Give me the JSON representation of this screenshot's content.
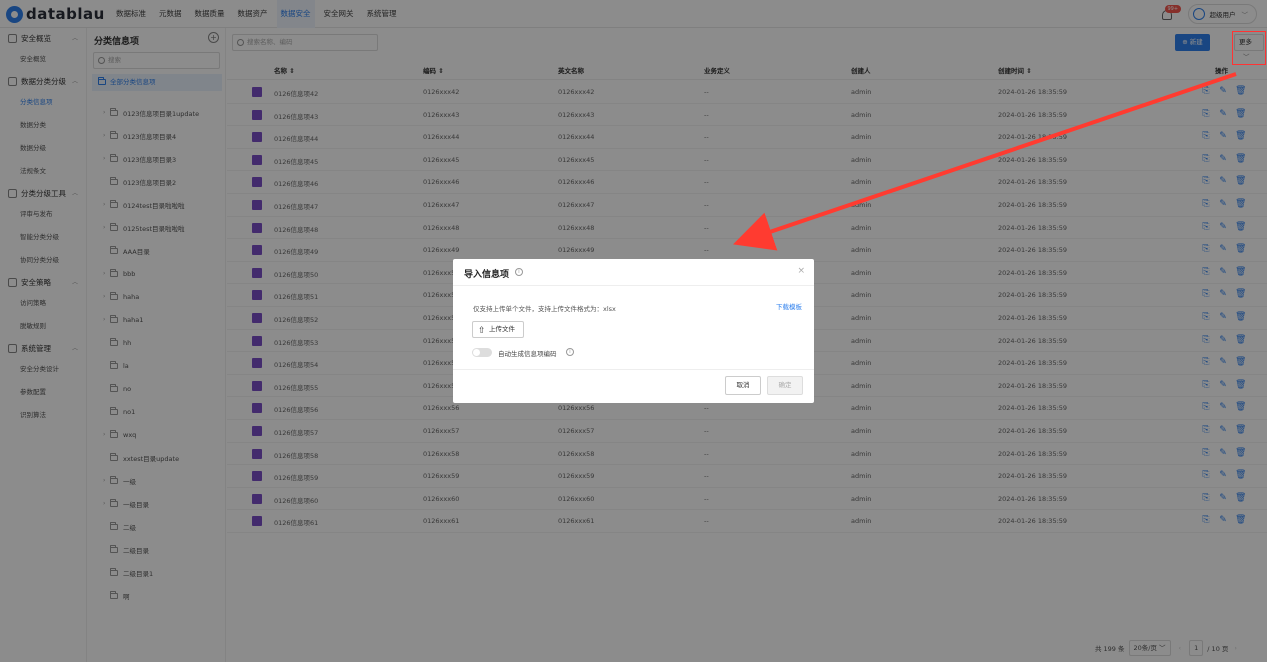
{
  "app": {
    "logo_text": "datablau"
  },
  "topnav": [
    {
      "label": "数据标准",
      "active": false
    },
    {
      "label": "元数据",
      "active": false
    },
    {
      "label": "数据质量",
      "active": false
    },
    {
      "label": "数据资产",
      "active": false
    },
    {
      "label": "数据安全",
      "active": true
    },
    {
      "label": "安全网关",
      "active": false
    },
    {
      "label": "系统管理",
      "active": false
    }
  ],
  "header": {
    "badge": "99+",
    "user": "超级用户"
  },
  "sidebar": {
    "groups": [
      {
        "label": "安全概览",
        "icon": "overview-icon",
        "items": [
          {
            "label": "安全概览"
          }
        ]
      },
      {
        "label": "数据分类分级",
        "icon": "grid-icon",
        "items": [
          {
            "label": "分类信息项",
            "active": true
          },
          {
            "label": "数据分类"
          },
          {
            "label": "数据分级"
          },
          {
            "label": "法规条文"
          }
        ]
      },
      {
        "label": "分类分级工具",
        "icon": "tool-icon",
        "items": [
          {
            "label": "评审与发布"
          },
          {
            "label": "智能分类分级"
          },
          {
            "label": "协同分类分级"
          }
        ]
      },
      {
        "label": "安全策略",
        "icon": "policy-icon",
        "items": [
          {
            "label": "访问策略"
          },
          {
            "label": "脱敏规则"
          }
        ]
      },
      {
        "label": "系统管理",
        "icon": "system-icon",
        "items": [
          {
            "label": "安全分类设计"
          },
          {
            "label": "参数配置"
          },
          {
            "label": "识别算法"
          }
        ]
      }
    ]
  },
  "tree_panel": {
    "title": "分类信息项",
    "search_placeholder": "搜索",
    "all_label": "全部分类信息项",
    "nodes": [
      {
        "label": "0123信息项目录1update",
        "expandable": true
      },
      {
        "label": "0123信息项目录4",
        "expandable": true
      },
      {
        "label": "0123信息项目录3",
        "expandable": true
      },
      {
        "label": "0123信息项目录2",
        "expandable": false
      },
      {
        "label": "0124test目录啦啦啦",
        "expandable": true
      },
      {
        "label": "0125test目录啦啦啦",
        "expandable": true
      },
      {
        "label": "AAA目录",
        "expandable": false
      },
      {
        "label": "bbb",
        "expandable": true
      },
      {
        "label": "haha",
        "expandable": true
      },
      {
        "label": "haha1",
        "expandable": true
      },
      {
        "label": "hh",
        "expandable": false
      },
      {
        "label": "la",
        "expandable": false
      },
      {
        "label": "no",
        "expandable": false
      },
      {
        "label": "no1",
        "expandable": false
      },
      {
        "label": "wxq",
        "expandable": true
      },
      {
        "label": "xxtest目录update",
        "expandable": false
      },
      {
        "label": "一级",
        "expandable": true
      },
      {
        "label": "一级目录",
        "expandable": true
      },
      {
        "label": "二级",
        "expandable": false
      },
      {
        "label": "二级目录",
        "expandable": false
      },
      {
        "label": "二级目录1",
        "expandable": false
      },
      {
        "label": "啊",
        "expandable": false
      }
    ]
  },
  "toolbar": {
    "search_placeholder": "搜索名称、编码",
    "new_label": "新建",
    "more_label": "更多"
  },
  "table": {
    "headers": {
      "name": "名称 ⇕",
      "code": "编码 ⇕",
      "en": "英文名称",
      "biz": "业务定义",
      "creator": "创建人",
      "created": "创建时间 ⇕",
      "ops": "操作"
    },
    "rows": [
      {
        "name": "0126信息项42",
        "code": "0126xxx42",
        "en": "0126xxx42",
        "biz": "--",
        "creator": "admin",
        "created": "2024-01-26 18:35:59"
      },
      {
        "name": "0126信息项43",
        "code": "0126xxx43",
        "en": "0126xxx43",
        "biz": "--",
        "creator": "admin",
        "created": "2024-01-26 18:35:59"
      },
      {
        "name": "0126信息项44",
        "code": "0126xxx44",
        "en": "0126xxx44",
        "biz": "--",
        "creator": "admin",
        "created": "2024-01-26 18:35:59"
      },
      {
        "name": "0126信息项45",
        "code": "0126xxx45",
        "en": "0126xxx45",
        "biz": "--",
        "creator": "admin",
        "created": "2024-01-26 18:35:59"
      },
      {
        "name": "0126信息项46",
        "code": "0126xxx46",
        "en": "0126xxx46",
        "biz": "--",
        "creator": "admin",
        "created": "2024-01-26 18:35:59"
      },
      {
        "name": "0126信息项47",
        "code": "0126xxx47",
        "en": "0126xxx47",
        "biz": "--",
        "creator": "admin",
        "created": "2024-01-26 18:35:59"
      },
      {
        "name": "0126信息项48",
        "code": "0126xxx48",
        "en": "0126xxx48",
        "biz": "--",
        "creator": "admin",
        "created": "2024-01-26 18:35:59"
      },
      {
        "name": "0126信息项49",
        "code": "0126xxx49",
        "en": "0126xxx49",
        "biz": "--",
        "creator": "admin",
        "created": "2024-01-26 18:35:59"
      },
      {
        "name": "0126信息项50",
        "code": "0126xxx50",
        "en": "0126xxx50",
        "biz": "--",
        "creator": "admin",
        "created": "2024-01-26 18:35:59"
      },
      {
        "name": "0126信息项51",
        "code": "0126xxx51",
        "en": "0126xxx51",
        "biz": "--",
        "creator": "admin",
        "created": "2024-01-26 18:35:59"
      },
      {
        "name": "0126信息项52",
        "code": "0126xxx52",
        "en": "0126xxx52",
        "biz": "--",
        "creator": "admin",
        "created": "2024-01-26 18:35:59"
      },
      {
        "name": "0126信息项53",
        "code": "0126xxx53",
        "en": "0126xxx53",
        "biz": "--",
        "creator": "admin",
        "created": "2024-01-26 18:35:59"
      },
      {
        "name": "0126信息项54",
        "code": "0126xxx54",
        "en": "0126xxx54",
        "biz": "--",
        "creator": "admin",
        "created": "2024-01-26 18:35:59"
      },
      {
        "name": "0126信息项55",
        "code": "0126xxx55",
        "en": "0126xxx55",
        "biz": "--",
        "creator": "admin",
        "created": "2024-01-26 18:35:59"
      },
      {
        "name": "0126信息项56",
        "code": "0126xxx56",
        "en": "0126xxx56",
        "biz": "--",
        "creator": "admin",
        "created": "2024-01-26 18:35:59"
      },
      {
        "name": "0126信息项57",
        "code": "0126xxx57",
        "en": "0126xxx57",
        "biz": "--",
        "creator": "admin",
        "created": "2024-01-26 18:35:59"
      },
      {
        "name": "0126信息项58",
        "code": "0126xxx58",
        "en": "0126xxx58",
        "biz": "--",
        "creator": "admin",
        "created": "2024-01-26 18:35:59"
      },
      {
        "name": "0126信息项59",
        "code": "0126xxx59",
        "en": "0126xxx59",
        "biz": "--",
        "creator": "admin",
        "created": "2024-01-26 18:35:59"
      },
      {
        "name": "0126信息项60",
        "code": "0126xxx60",
        "en": "0126xxx60",
        "biz": "--",
        "creator": "admin",
        "created": "2024-01-26 18:35:59"
      },
      {
        "name": "0126信息项61",
        "code": "0126xxx61",
        "en": "0126xxx61",
        "biz": "--",
        "creator": "admin",
        "created": "2024-01-26 18:35:59"
      }
    ]
  },
  "pagination": {
    "total": "共 199 条",
    "page_size": "20条/页",
    "current": "1",
    "of": "/ 10 页"
  },
  "modal": {
    "title": "导入信息项",
    "description": "仅支持上传单个文件，支持上传文件格式为：xlsx",
    "download": "下载模板",
    "upload": "上传文件",
    "toggle_label": "自动生成信息项编码",
    "cancel": "取消",
    "ok": "确定"
  },
  "colors": {
    "accent": "#2f80ed",
    "annotation": "#ff3b30",
    "row_icon": "#7b4fc6"
  }
}
